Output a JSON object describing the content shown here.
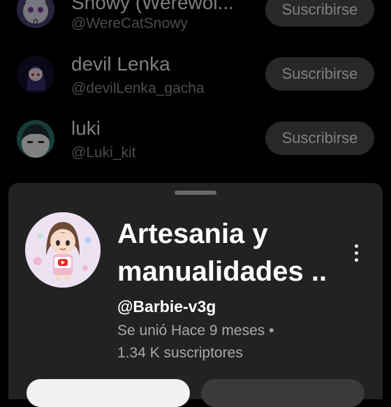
{
  "list": {
    "rows": [
      {
        "name": "Snowy (Werewol...",
        "handle": "@WereCatSnowy",
        "button": "Suscribirse",
        "avatar_icon": "cat-avatar-icon"
      },
      {
        "name": "devil Lenka",
        "handle": "@devilLenka_gacha",
        "button": "Suscribirse",
        "avatar_icon": "gacha-character-avatar-icon"
      },
      {
        "name": "luki",
        "handle": "@Luki_kit",
        "button": "Suscribirse",
        "avatar_icon": "chibi-face-avatar-icon"
      }
    ]
  },
  "sheet": {
    "title_line1": "Artesania y",
    "title_line2": "manualidades ..",
    "handle": "@Barbie-v3g",
    "joined": "Se unió Hace 9 meses •",
    "subscribers": "1.34 K suscriptores",
    "avatar_icon": "doll-with-youtube-logo-avatar-icon",
    "menu_icon": "more-vert-icon"
  },
  "colors": {
    "background": "#000000",
    "sheet": "#222222",
    "button": "#4a4a4a",
    "secondary_text": "#8a8a8a"
  }
}
